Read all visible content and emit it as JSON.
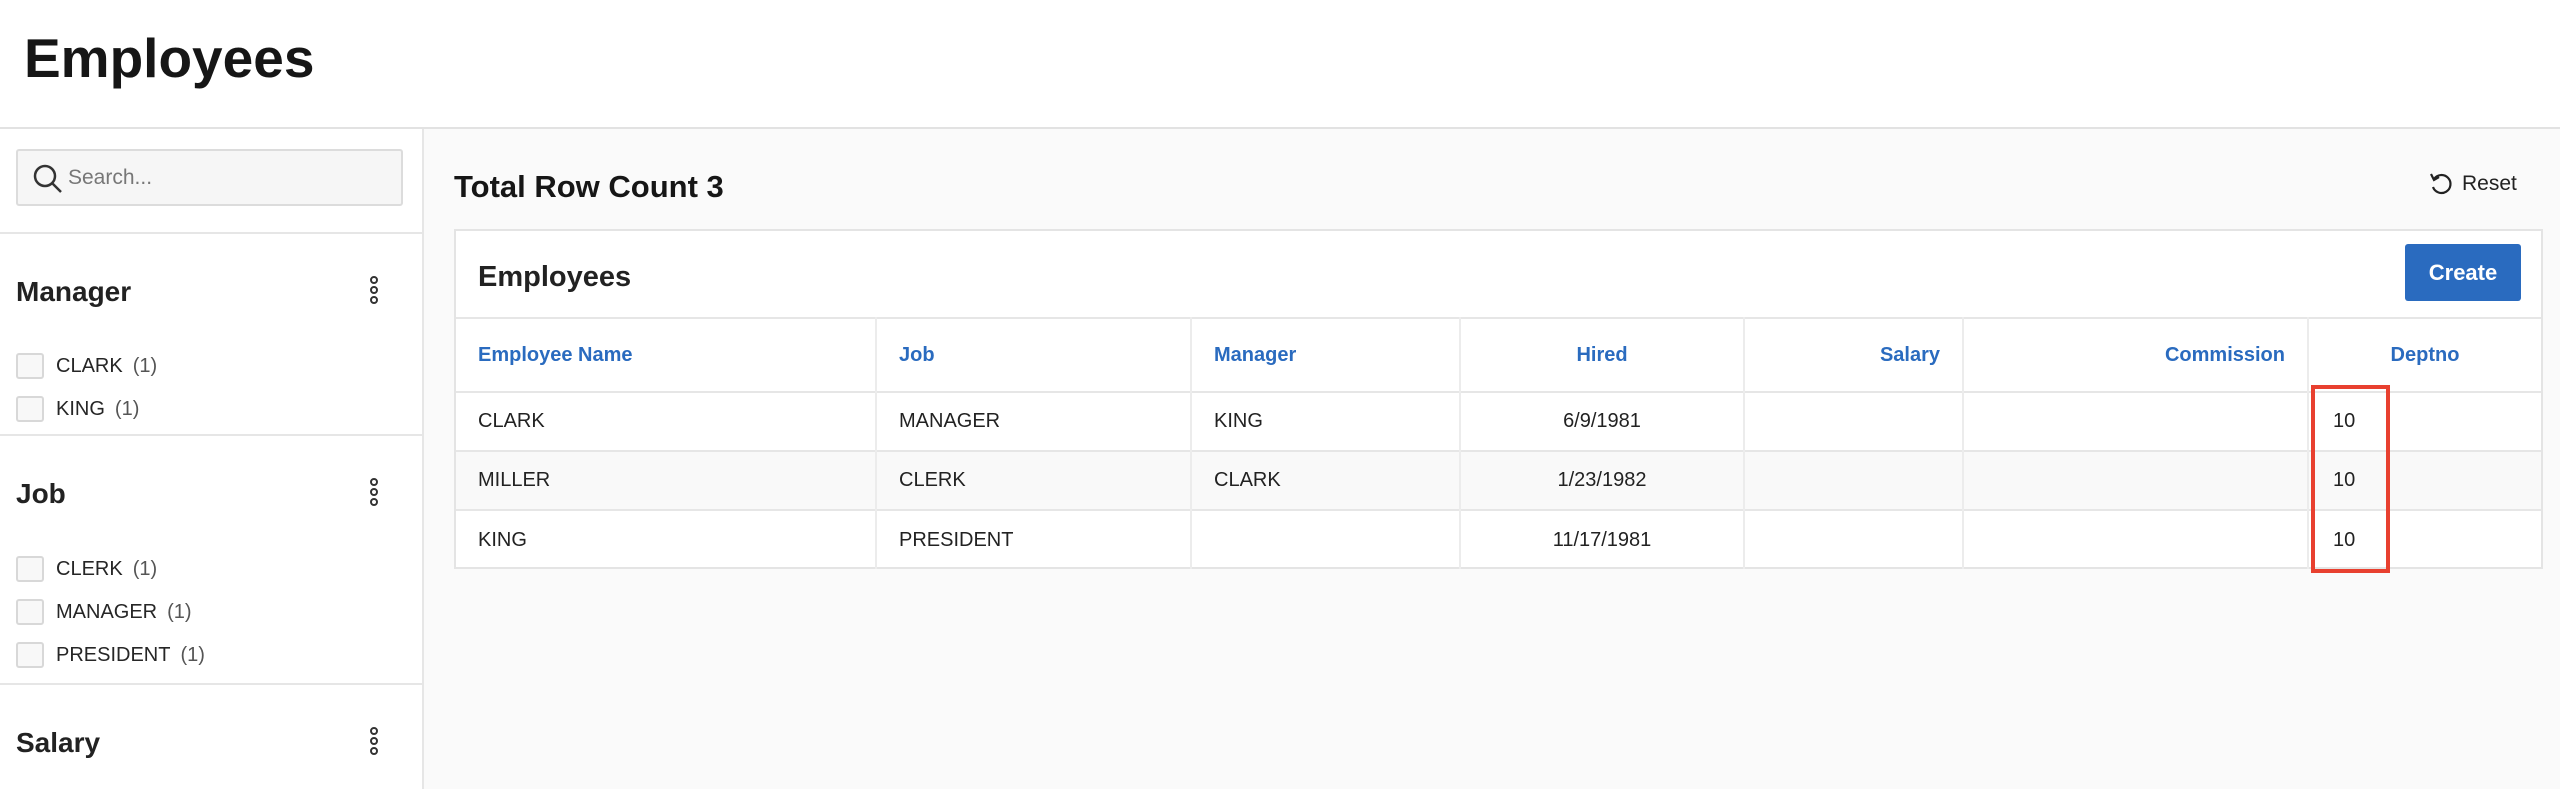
{
  "page": {
    "title": "Employees"
  },
  "sidebar": {
    "search": {
      "placeholder": "Search..."
    },
    "facets": [
      {
        "title": "Manager",
        "options": [
          {
            "label": "CLARK",
            "count": "(1)"
          },
          {
            "label": "KING",
            "count": "(1)"
          }
        ]
      },
      {
        "title": "Job",
        "options": [
          {
            "label": "CLERK",
            "count": "(1)"
          },
          {
            "label": "MANAGER",
            "count": "(1)"
          },
          {
            "label": "PRESIDENT",
            "count": "(1)"
          }
        ]
      },
      {
        "title": "Salary",
        "options": []
      }
    ]
  },
  "main": {
    "row_count": "Total Row Count 3",
    "reset_label": "Reset",
    "region_title": "Employees",
    "create_label": "Create",
    "columns": [
      "Employee Name",
      "Job",
      "Manager",
      "Hired",
      "Salary",
      "Commission",
      "Deptno"
    ],
    "rows": [
      [
        "CLARK",
        "MANAGER",
        "KING",
        "6/9/1981",
        "",
        "",
        "10"
      ],
      [
        "MILLER",
        "CLERK",
        "CLARK",
        "1/23/1982",
        "",
        "",
        "10"
      ],
      [
        "KING",
        "PRESIDENT",
        "",
        "11/17/1981",
        "",
        "",
        "10"
      ]
    ]
  },
  "colors": {
    "accent": "#2a6bbf",
    "highlight": "#e8402f"
  }
}
